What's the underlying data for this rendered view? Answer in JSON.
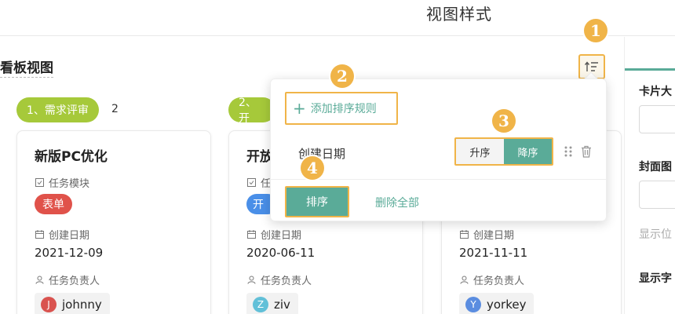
{
  "header": {
    "title": "视图样式"
  },
  "board": {
    "title": "看板视图"
  },
  "columns": [
    {
      "label": "1、需求评审",
      "count": "2"
    },
    {
      "label": "2、开"
    }
  ],
  "cards": [
    {
      "title": "新版PC优化",
      "module_label": "任务模块",
      "tag": "表单",
      "date_label": "创建日期",
      "date": "2021-12-09",
      "owner_label": "任务负责人",
      "owner": {
        "initial": "J",
        "name": "johnny",
        "color": "#d9534f"
      }
    },
    {
      "title": "开放",
      "module_label": "任",
      "tag": "开",
      "date_label": "创建日期",
      "date": "2020-06-11",
      "owner_label": "任务负责人",
      "owner": {
        "initial": "Z",
        "name": "ziv",
        "color": "#62c0d8"
      }
    },
    {
      "title": "",
      "date_label": "创建日期",
      "date": "2021-11-11",
      "owner_label": "任务负责人",
      "owner": {
        "initial": "Y",
        "name": "yorkey",
        "color": "#5b8de0"
      }
    }
  ],
  "popover": {
    "add_rule": "添加排序规则",
    "rule_field": "创建日期",
    "asc": "升序",
    "desc": "降序",
    "selected_order": "降序",
    "apply": "排序",
    "clear_all": "删除全部"
  },
  "right_panel": {
    "card_size_label": "卡片大",
    "cover_label": "封面图",
    "show_pos_label": "显示位",
    "show_field_label": "显示字"
  },
  "callouts": [
    "1",
    "2",
    "3",
    "4"
  ],
  "colors": {
    "accent": "#5aab98",
    "callout": "#f0b448",
    "column_chip": "#a6c93a",
    "tag_red": "#e0524a",
    "tag_blue": "#4a8fe8"
  },
  "icons": [
    "sort-icon",
    "plus-icon",
    "module-icon",
    "calendar-icon",
    "user-icon",
    "drag-handle-icon",
    "trash-icon"
  ]
}
